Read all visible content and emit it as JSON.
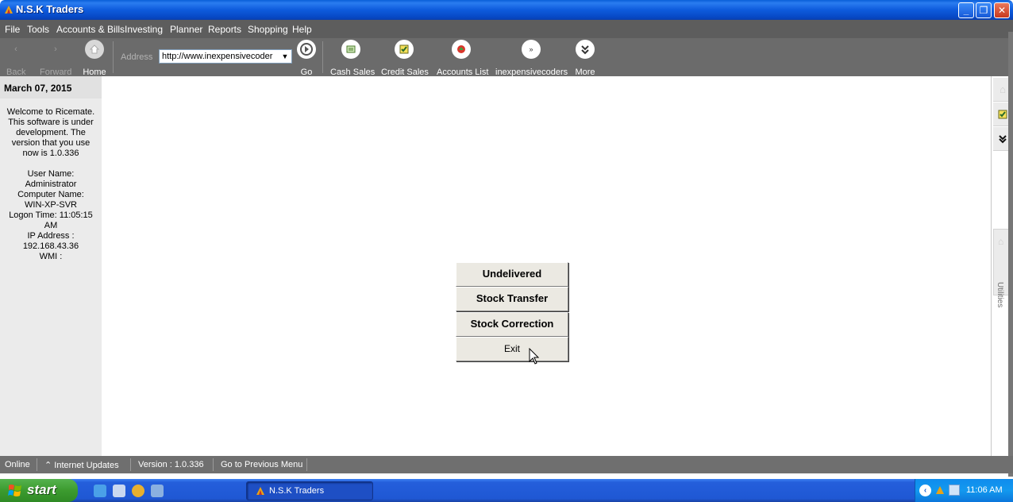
{
  "window": {
    "title": "N.S.K Traders",
    "min_label": "_",
    "max_label": "❐",
    "close_label": "✕"
  },
  "menu": [
    "File",
    "Tools",
    "Accounts & Bills",
    "Investing",
    "Planner",
    "Reports",
    "Shopping",
    "Help"
  ],
  "toolbar": {
    "back_label": "Back",
    "forward_label": "Forward",
    "home_label": "Home",
    "address_label": "Address",
    "address_value": "http://www.inexpensivecoder",
    "go_label": "Go",
    "cash_sales_label": "Cash Sales",
    "credit_sales_label": "Credit Sales",
    "accounts_list_label": "Accounts List",
    "inexpensivecoders_label": "inexpensivecoders",
    "more_label": "More"
  },
  "sidebar": {
    "date": "March 07, 2015",
    "welcome_lines": [
      "Welcome to Ricemate.",
      "This software is under",
      "development. The",
      "version that you use",
      "now is 1.0.336"
    ],
    "info_lines": [
      "User Name:",
      "Administrator",
      "Computer Name:",
      "WIN-XP-SVR",
      "Logon Time: 11:05:15",
      "AM",
      "IP Address :",
      "192.168.43.36",
      "WMI :"
    ]
  },
  "main": {
    "buttons": [
      "Undelivered",
      "Stock Transfer",
      "Stock Correction",
      "Exit"
    ]
  },
  "right_panel": {
    "utilities_label": "Utilities"
  },
  "status": {
    "online": "Online",
    "internet_updates": "Internet Updates",
    "version": "Version : 1.0.336",
    "previous_menu": "Go to Previous Menu"
  },
  "taskbar": {
    "start_label": "start",
    "task_item": "N.S.K Traders",
    "clock": "11:06 AM"
  },
  "colors": {
    "titlebar": "#0a5fd8",
    "menubar": "#5d5d5d",
    "toolbar": "#6b6b6b",
    "sidebar": "#ebebeb",
    "statusbar": "#6f6f6f",
    "taskbar": "#245edb",
    "start_button": "#3c9b2f"
  },
  "icons": [
    "app-icon",
    "home-icon",
    "go-icon",
    "cash-sales-icon",
    "credit-sales-icon",
    "accounts-list-icon",
    "inexpensivecoders-icon",
    "more-icon",
    "checkbox-icon",
    "double-chevron-icon",
    "windows-flag-icon",
    "cursor-icon"
  ]
}
